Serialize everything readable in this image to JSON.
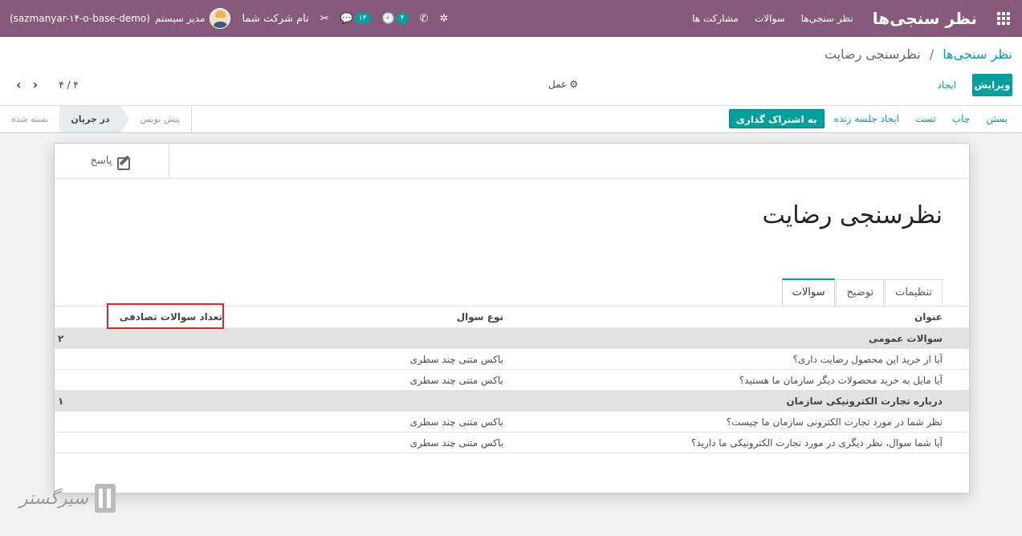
{
  "navbar": {
    "app_title": "نظر سنجی‌ها",
    "menu": [
      "نظر سنجی‌ها",
      "سوالات",
      "مشارکت ها"
    ],
    "db_name": "(sazmanyar-۱۴-o-base-demo)",
    "user_name": "مدیر سیستم",
    "company": "نام شرکت شما",
    "messages_count": "۱۴",
    "activities_count": "۴"
  },
  "breadcrumb": {
    "parent": "نظر سنجی‌ها",
    "separator": "/",
    "current": "نظرسنجی رضایت"
  },
  "buttons": {
    "edit": "ویرایش",
    "create": "ایجاد",
    "action": "عمل"
  },
  "pager": {
    "value": "۴ / ۴"
  },
  "header_buttons": [
    "به اشتراک گذاری",
    "ایجاد جلسه زنده",
    "تست",
    "چاپ",
    "بستن"
  ],
  "stages": [
    "پیش نویس",
    "در جریان",
    "بسته شده"
  ],
  "active_stage_index": 1,
  "answers_button": "پاسخ",
  "form_title": "نظرسنجی رضایت",
  "tabs": [
    "سوالات",
    "توضیح",
    "تنظیمات"
  ],
  "table": {
    "headers": {
      "title": "عنوان",
      "type": "نوع سوال",
      "random_count": "تعداد سوالات تصادفی"
    },
    "rows": [
      {
        "kind": "section",
        "title": "سوالات عمومی",
        "type": "",
        "count": "۲"
      },
      {
        "kind": "question",
        "title": "آیا از خرید این محصول رضایت داری؟",
        "type": "باکس متنی چند سطری",
        "count": ""
      },
      {
        "kind": "question",
        "title": "آیا مایل به خرید محصولات دیگر سازمان ما هستید؟",
        "type": "باکس متنی چند سطری",
        "count": ""
      },
      {
        "kind": "section",
        "title": "درباره تجارت الکترونیکی سازمان",
        "type": "",
        "count": "۱"
      },
      {
        "kind": "question",
        "title": "نظر شما در مورد تجارت الکترونی سازمان ما چیست؟",
        "type": "باکس متنی چند سطری",
        "count": ""
      },
      {
        "kind": "question",
        "title": "آیا شما سوال، نظر دیگری در مورد تجارت الکترونیکی ما دارید؟",
        "type": "باکس متنی چند سطری",
        "count": ""
      }
    ]
  },
  "watermark": "سیرگستر",
  "colors": {
    "navbar": "#875a7b",
    "primary": "#00a09d",
    "highlight": "#e0262c"
  }
}
